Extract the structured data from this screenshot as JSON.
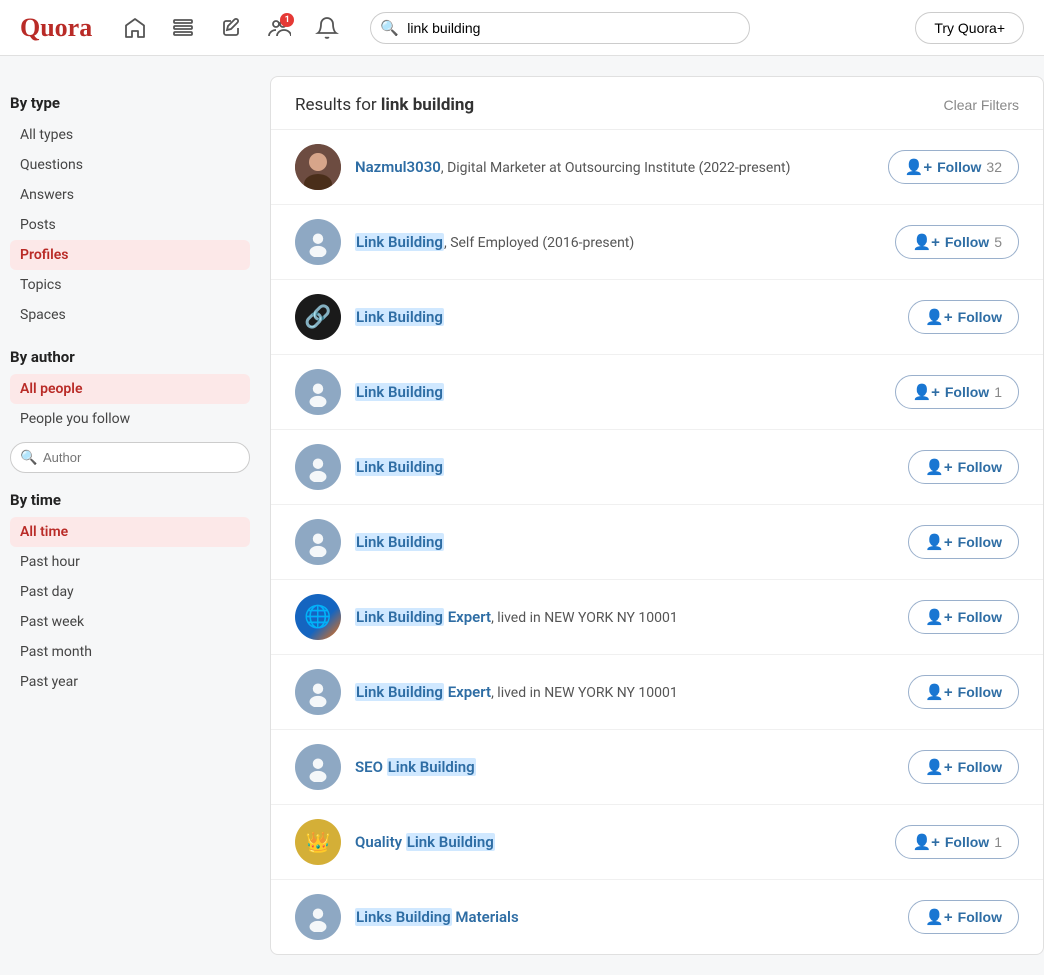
{
  "header": {
    "logo": "Quora",
    "search_value": "link building",
    "search_placeholder": "link building",
    "try_btn": "Try Quora+"
  },
  "sidebar": {
    "by_type_title": "By type",
    "type_items": [
      {
        "label": "All types",
        "active": false
      },
      {
        "label": "Questions",
        "active": false
      },
      {
        "label": "Answers",
        "active": false
      },
      {
        "label": "Posts",
        "active": false
      },
      {
        "label": "Profiles",
        "active": true
      },
      {
        "label": "Topics",
        "active": false
      },
      {
        "label": "Spaces",
        "active": false
      }
    ],
    "by_author_title": "By author",
    "author_items": [
      {
        "label": "All people",
        "active": true
      },
      {
        "label": "People you follow",
        "active": false
      }
    ],
    "author_placeholder": "Author",
    "by_time_title": "By time",
    "time_items": [
      {
        "label": "All time",
        "active": true
      },
      {
        "label": "Past hour",
        "active": false
      },
      {
        "label": "Past day",
        "active": false
      },
      {
        "label": "Past week",
        "active": false
      },
      {
        "label": "Past month",
        "active": false
      },
      {
        "label": "Past year",
        "active": false
      }
    ]
  },
  "results": {
    "title_prefix": "Results for ",
    "title_query": "link building",
    "clear_filters": "Clear Filters",
    "items": [
      {
        "id": 1,
        "name": "Nazmul3030",
        "description": ", Digital Marketer at Outsourcing Institute (2022-present)",
        "avatar_type": "photo",
        "follow_label": "Follow",
        "follow_count": "32"
      },
      {
        "id": 2,
        "name": "Link Building",
        "description": ", Self Employed (2016-present)",
        "avatar_type": "default",
        "follow_label": "Follow",
        "follow_count": "5"
      },
      {
        "id": 3,
        "name": "Link Building",
        "description": "",
        "avatar_type": "link",
        "follow_label": "Follow",
        "follow_count": ""
      },
      {
        "id": 4,
        "name": "Link Building",
        "description": "",
        "avatar_type": "default",
        "follow_label": "Follow",
        "follow_count": "1"
      },
      {
        "id": 5,
        "name": "Link Building",
        "description": "",
        "avatar_type": "default",
        "follow_label": "Follow",
        "follow_count": ""
      },
      {
        "id": 6,
        "name": "Link Building",
        "description": "",
        "avatar_type": "default",
        "follow_label": "Follow",
        "follow_count": ""
      },
      {
        "id": 7,
        "name": "Link Building Expert",
        "description": ", lived in NEW YORK NY 10001",
        "avatar_type": "globe",
        "follow_label": "Follow",
        "follow_count": ""
      },
      {
        "id": 8,
        "name": "Link Building Expert",
        "description": ", lived in NEW YORK NY 10001",
        "avatar_type": "default",
        "follow_label": "Follow",
        "follow_count": ""
      },
      {
        "id": 9,
        "name": "SEO Link Building",
        "description": "",
        "avatar_type": "default",
        "follow_label": "Follow",
        "follow_count": ""
      },
      {
        "id": 10,
        "name": "Quality Link Building",
        "description": "",
        "avatar_type": "crest",
        "follow_label": "Follow",
        "follow_count": "1"
      },
      {
        "id": 11,
        "name": "Links Building Materials",
        "description": "",
        "avatar_type": "default",
        "follow_label": "Follow",
        "follow_count": ""
      }
    ]
  }
}
